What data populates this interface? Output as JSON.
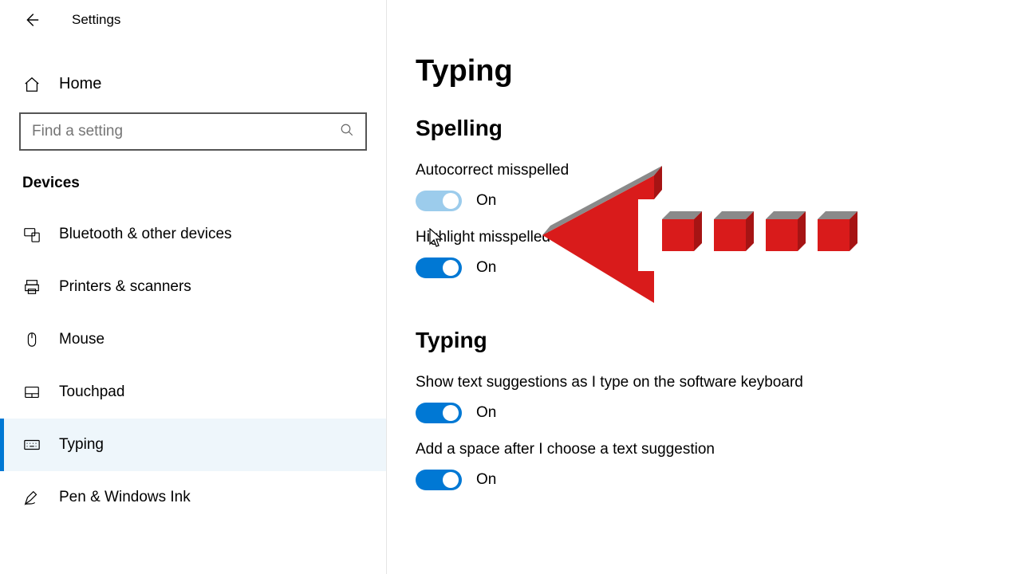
{
  "header": {
    "title": "Settings"
  },
  "sidebar": {
    "home_label": "Home",
    "search_placeholder": "Find a setting",
    "category": "Devices",
    "items": [
      {
        "label": "Bluetooth & other devices",
        "icon": "bluetooth-devices-icon",
        "active": false
      },
      {
        "label": "Printers & scanners",
        "icon": "printer-icon",
        "active": false
      },
      {
        "label": "Mouse",
        "icon": "mouse-icon",
        "active": false
      },
      {
        "label": "Touchpad",
        "icon": "touchpad-icon",
        "active": false
      },
      {
        "label": "Typing",
        "icon": "keyboard-icon",
        "active": true
      },
      {
        "label": "Pen & Windows Ink",
        "icon": "pen-icon",
        "active": false
      }
    ]
  },
  "main": {
    "title": "Typing",
    "sections": {
      "spelling": {
        "heading": "Spelling",
        "autocorrect": {
          "label": "Autocorrect misspelled",
          "state": "On"
        },
        "highlight": {
          "label": "Highlight misspelled wo",
          "state": "On"
        }
      },
      "typing": {
        "heading": "Typing",
        "suggestions": {
          "label": "Show text suggestions as I type on the software keyboard",
          "state": "On"
        },
        "add_space": {
          "label": "Add a space after I choose a text suggestion",
          "state": "On"
        }
      }
    }
  },
  "annotation": {
    "kind": "red-3d-arrow-left",
    "color": "#d91b1b"
  }
}
